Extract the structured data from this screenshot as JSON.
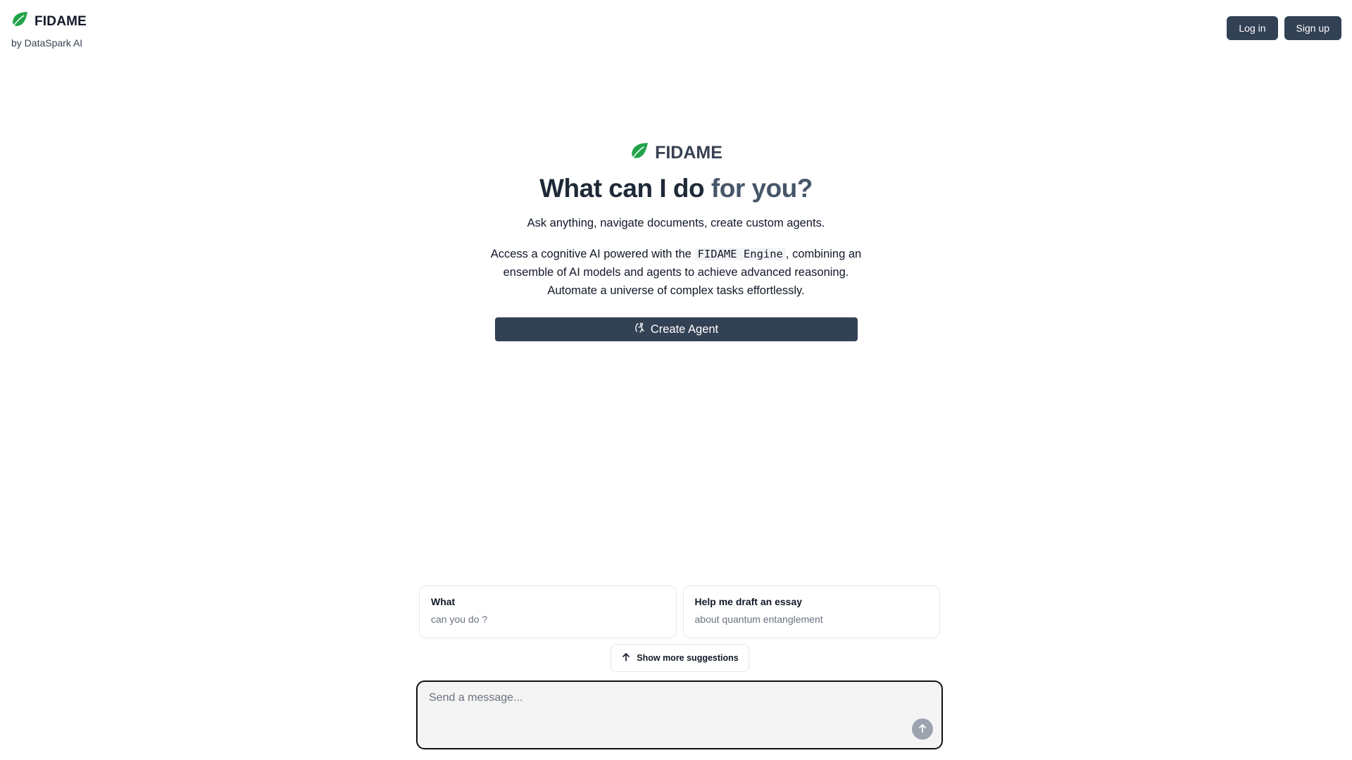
{
  "brand": {
    "name": "FIDAME",
    "subtitle": "by DataSpark AI",
    "logo_icon": "leaf-icon",
    "logo_color": "#22a34a"
  },
  "auth": {
    "login_label": "Log in",
    "signup_label": "Sign up"
  },
  "hero": {
    "logo_name": "FIDAME",
    "title_part1": "What can I do ",
    "title_part2": "for you?",
    "tagline": "Ask anything, navigate documents, create custom agents.",
    "desc_before": "Access a cognitive AI powered with the ",
    "desc_code": "FIDAME Engine",
    "desc_after": ", combining an ensemble of AI models and agents to achieve advanced reasoning. Automate a universe of complex tasks effortlessly.",
    "create_agent_label": "Create Agent",
    "create_agent_icon": "agent-icon"
  },
  "suggestions": [
    {
      "title": "What",
      "subtitle": "can you do ?"
    },
    {
      "title": "Help me draft an essay",
      "subtitle": "about quantum entanglement"
    }
  ],
  "more_suggestions_label": "Show more suggestions",
  "composer": {
    "placeholder": "Send a message...",
    "value": ""
  },
  "colors": {
    "primary_dark": "#334155",
    "accent_green": "#22a34a"
  }
}
